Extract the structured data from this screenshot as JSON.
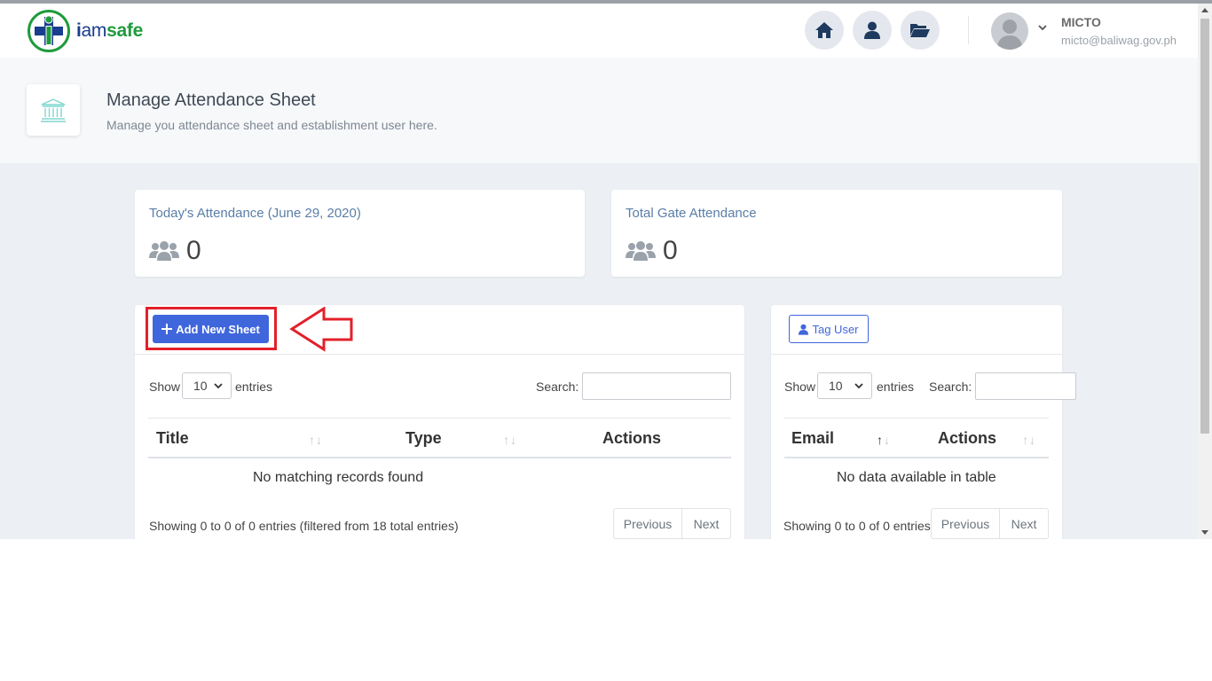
{
  "header": {
    "logo": {
      "i": "i",
      "am": "am",
      "safe": "safe"
    },
    "nav_icons": [
      "home-icon",
      "user-icon",
      "folder-open-icon"
    ],
    "user": {
      "name": "MICTO",
      "email": "micto@baliwag.gov.ph"
    }
  },
  "page": {
    "title": "Manage Attendance Sheet",
    "subtitle": "Manage you attendance sheet and establishment user here.",
    "icon": "bank-icon"
  },
  "stats": [
    {
      "title": "Today's Attendance (June 29, 2020)",
      "value": "0",
      "icon": "users-icon"
    },
    {
      "title": "Total Gate Attendance",
      "value": "0",
      "icon": "users-icon"
    }
  ],
  "sheets_table": {
    "add_button": "Add New Sheet",
    "show_label": "Show",
    "entries_value": "10",
    "entries_label": "entries",
    "search_label": "Search:",
    "search_value": "",
    "columns": [
      "Title",
      "Type",
      "Actions"
    ],
    "empty_text": "No matching records found",
    "info_text": "Showing 0 to 0 of 0 entries (filtered from 18 total entries)",
    "prev_label": "Previous",
    "next_label": "Next"
  },
  "users_table": {
    "tag_button": "Tag User",
    "show_label": "Show",
    "entries_value": "10",
    "entries_label": "entries",
    "search_label": "Search:",
    "search_value": "",
    "columns": [
      "Email",
      "Actions"
    ],
    "empty_text": "No data available in table",
    "info_text": "Showing 0 to 0 of 0 entries",
    "prev_label": "Previous",
    "next_label": "Next"
  },
  "colors": {
    "primary": "#3f66db",
    "annotation": "#e3202a",
    "brand_blue": "#1a3d8f",
    "brand_green": "#1e9b3c"
  }
}
